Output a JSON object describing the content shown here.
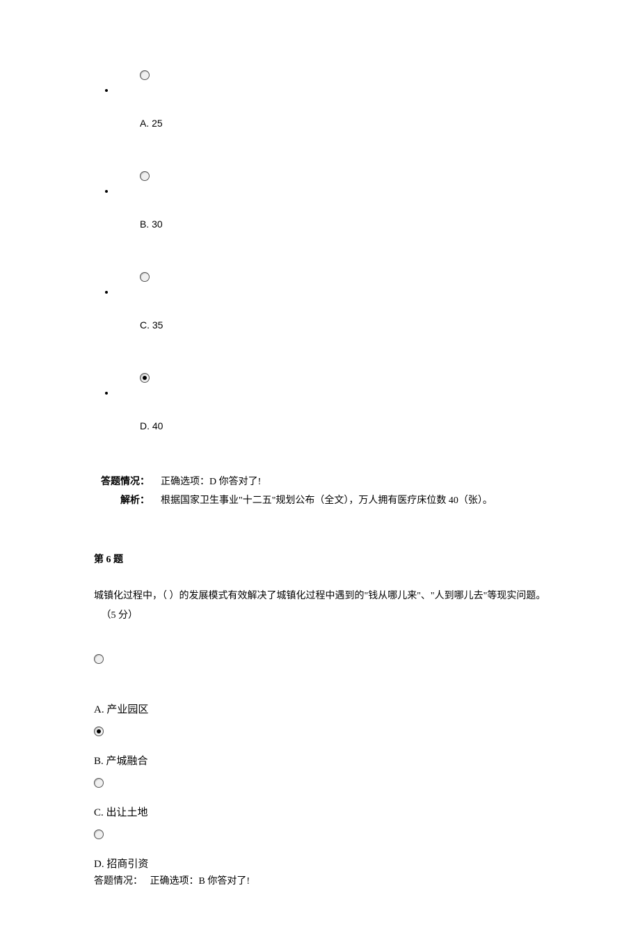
{
  "q5": {
    "options": {
      "A": "A. 25",
      "B": "B. 30",
      "C": "C. 35",
      "D": "D. 40"
    },
    "selected": "D",
    "result_label": "答题情况：",
    "result_value": "正确选项：D  你答对了!",
    "analysis_label": "解析：",
    "analysis_value": "根据国家卫生事业\"十二五\"规划公布（全文），万人拥有医疗床位数 40（张）。"
  },
  "q6": {
    "header": "第 6 题",
    "text_prefix": "城镇化过程中，（   ）的发展模式有效解决了城镇化过程中遇到的\"钱从哪儿来\"、\"人到哪儿去\"等现实问题。",
    "score": "（5 分）",
    "options": {
      "A": "A. 产业园区",
      "B": "B. 产城融合",
      "C": "C. 出让土地",
      "D": "D. 招商引资"
    },
    "selected": "B",
    "result_label": "答题情况：",
    "result_value": "正确选项：B  你答对了!"
  }
}
